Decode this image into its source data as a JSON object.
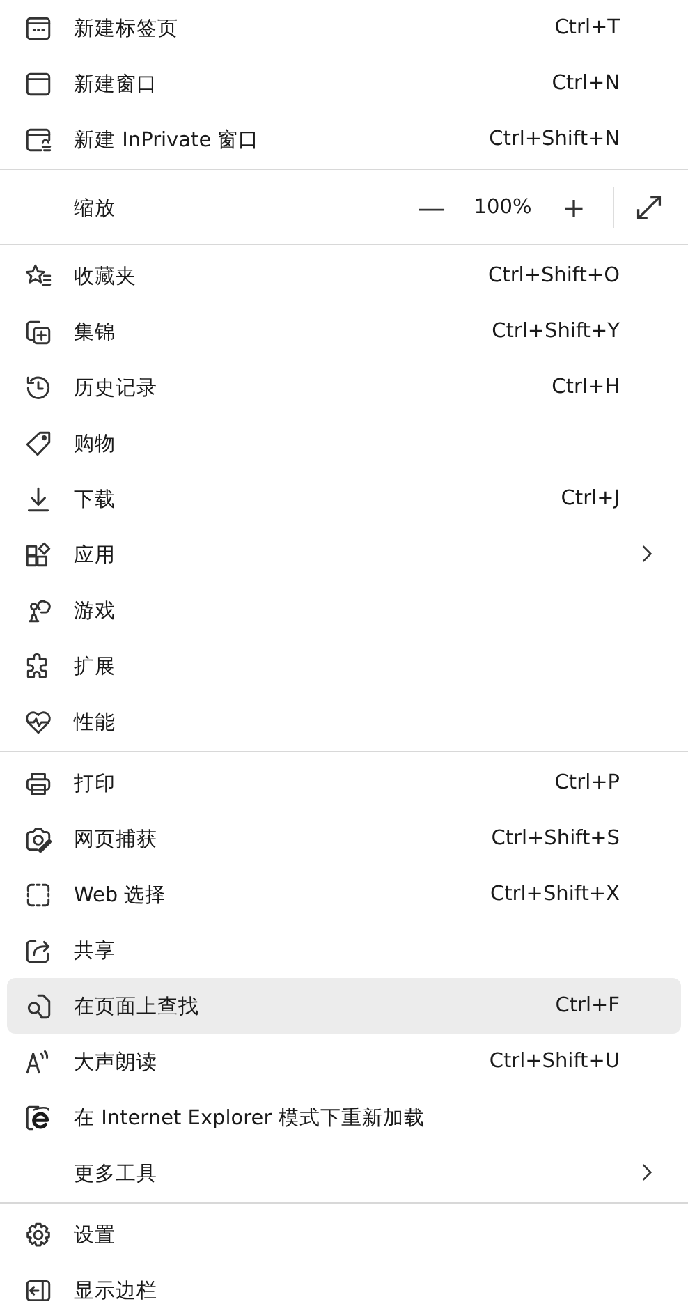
{
  "menu": {
    "sections": [
      {
        "items": [
          {
            "kind": "command",
            "label": "新建标签页",
            "shortcut": "Ctrl+T",
            "selected": false
          },
          {
            "kind": "command",
            "label": "新建窗口",
            "shortcut": "Ctrl+N",
            "selected": false
          },
          {
            "kind": "command",
            "label": "新建 InPrivate 窗口",
            "shortcut": "Ctrl+Shift+N",
            "selected": false
          }
        ]
      },
      {
        "items": [
          {
            "kind": "zoom",
            "label": "缩放",
            "minus": "—",
            "value": "100%",
            "plus": "+"
          }
        ]
      },
      {
        "items": [
          {
            "kind": "command",
            "label": "收藏夹",
            "shortcut": "Ctrl+Shift+O",
            "selected": false
          },
          {
            "kind": "command",
            "label": "集锦",
            "shortcut": "Ctrl+Shift+Y",
            "selected": false
          },
          {
            "kind": "command",
            "label": "历史记录",
            "shortcut": "Ctrl+H",
            "selected": false
          },
          {
            "kind": "command",
            "label": "购物",
            "selected": false
          },
          {
            "kind": "command",
            "label": "下载",
            "shortcut": "Ctrl+J",
            "selected": false
          },
          {
            "kind": "submenu",
            "label": "应用",
            "selected": false
          },
          {
            "kind": "command",
            "label": "游戏",
            "selected": false
          },
          {
            "kind": "command",
            "label": "扩展",
            "selected": false
          },
          {
            "kind": "command",
            "label": "性能",
            "selected": false
          }
        ]
      },
      {
        "items": [
          {
            "kind": "command",
            "label": "打印",
            "shortcut": "Ctrl+P",
            "selected": false
          },
          {
            "kind": "command",
            "label": "网页捕获",
            "shortcut": "Ctrl+Shift+S",
            "selected": false
          },
          {
            "kind": "command",
            "label": "Web 选择",
            "shortcut": "Ctrl+Shift+X",
            "selected": false
          },
          {
            "kind": "command",
            "label": "共享",
            "selected": false
          },
          {
            "kind": "command",
            "label": "在页面上查找",
            "shortcut": "Ctrl+F",
            "selected": true
          },
          {
            "kind": "command",
            "label": "大声朗读",
            "shortcut": "Ctrl+Shift+U",
            "selected": false
          },
          {
            "kind": "command",
            "label": "在 Internet Explorer 模式下重新加载",
            "selected": false
          },
          {
            "kind": "submenu",
            "label": "更多工具",
            "selected": false
          }
        ]
      },
      {
        "items": [
          {
            "kind": "command",
            "label": "设置",
            "selected": false
          },
          {
            "kind": "command",
            "label": "显示边栏",
            "selected": false
          }
        ]
      }
    ]
  }
}
